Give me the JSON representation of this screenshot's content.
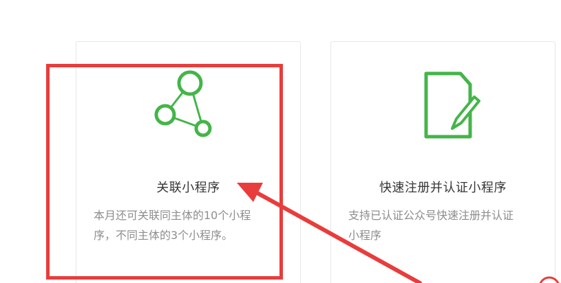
{
  "cards": [
    {
      "title": "关联小程序",
      "desc_line1": "本月还可关联同主体的10个小程",
      "desc_line2": "序，不同主体的3个小程序。",
      "icon": "network-nodes-icon"
    },
    {
      "title": "快速注册并认证小程序",
      "desc_line1": "支持已认证公众号快速注册并认证",
      "desc_line2": "小程序",
      "icon": "document-edit-icon"
    }
  ],
  "colors": {
    "icon_green": "#44b549",
    "annotation_red": "#e93c3c",
    "title_text": "#353535",
    "desc_text": "#8d8d8d",
    "card_border": "#e7e7eb"
  }
}
